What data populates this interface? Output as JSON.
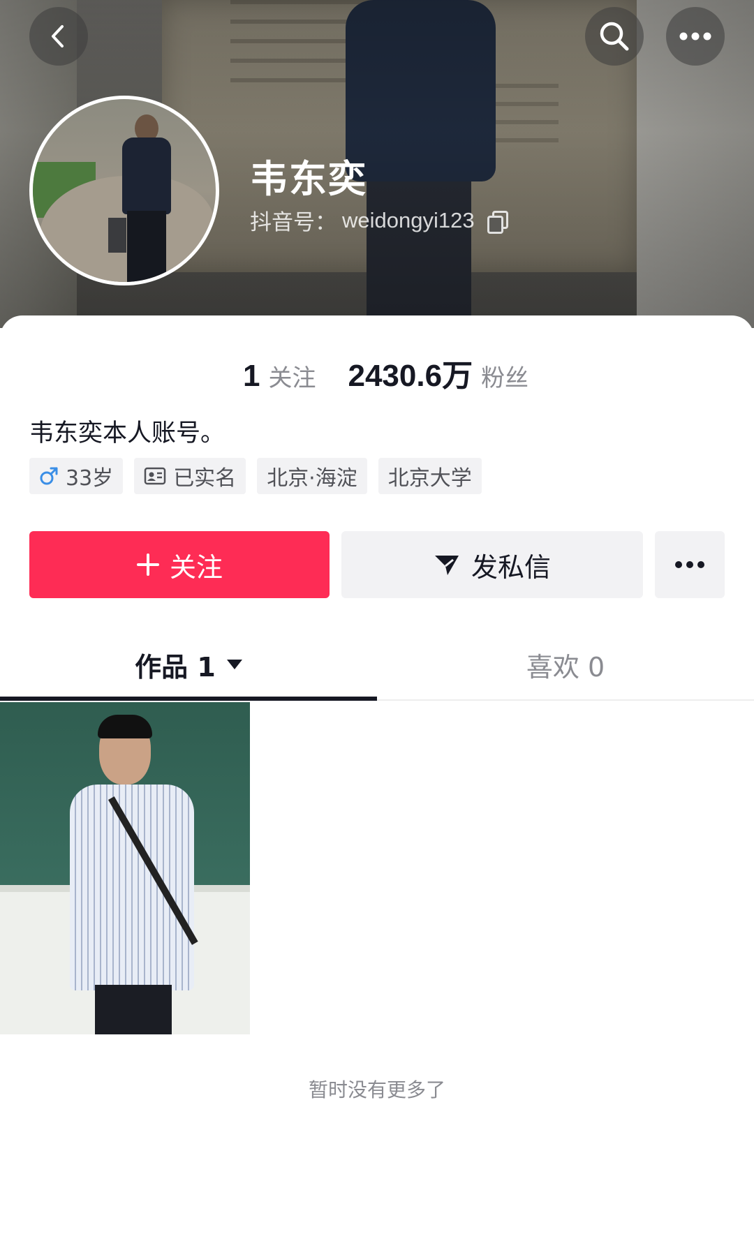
{
  "header": {
    "back_icon": "chevron-left-icon",
    "search_icon": "search-icon",
    "more_icon": "ellipsis-icon"
  },
  "profile": {
    "name": "韦东奕",
    "handle_label": "抖音号：",
    "handle_value": "weidongyi123",
    "copy_icon": "copy-icon"
  },
  "stats": {
    "following_count": "1",
    "following_label": "关注",
    "followers_count": "2430.6万",
    "followers_label": "粉丝"
  },
  "bio": "韦东奕本人账号。",
  "tags": [
    {
      "icon": "male-icon",
      "label": "33岁"
    },
    {
      "icon": "id-card-icon",
      "label": "已实名"
    },
    {
      "label": "北京·海淀"
    },
    {
      "label": "北京大学"
    }
  ],
  "actions": {
    "follow_label": "关注",
    "message_label": "发私信",
    "follow_color": "#fe2c55"
  },
  "tabs": {
    "works_label": "作品 1",
    "likes_label": "喜欢 0"
  },
  "footer_text": "暂时没有更多了"
}
